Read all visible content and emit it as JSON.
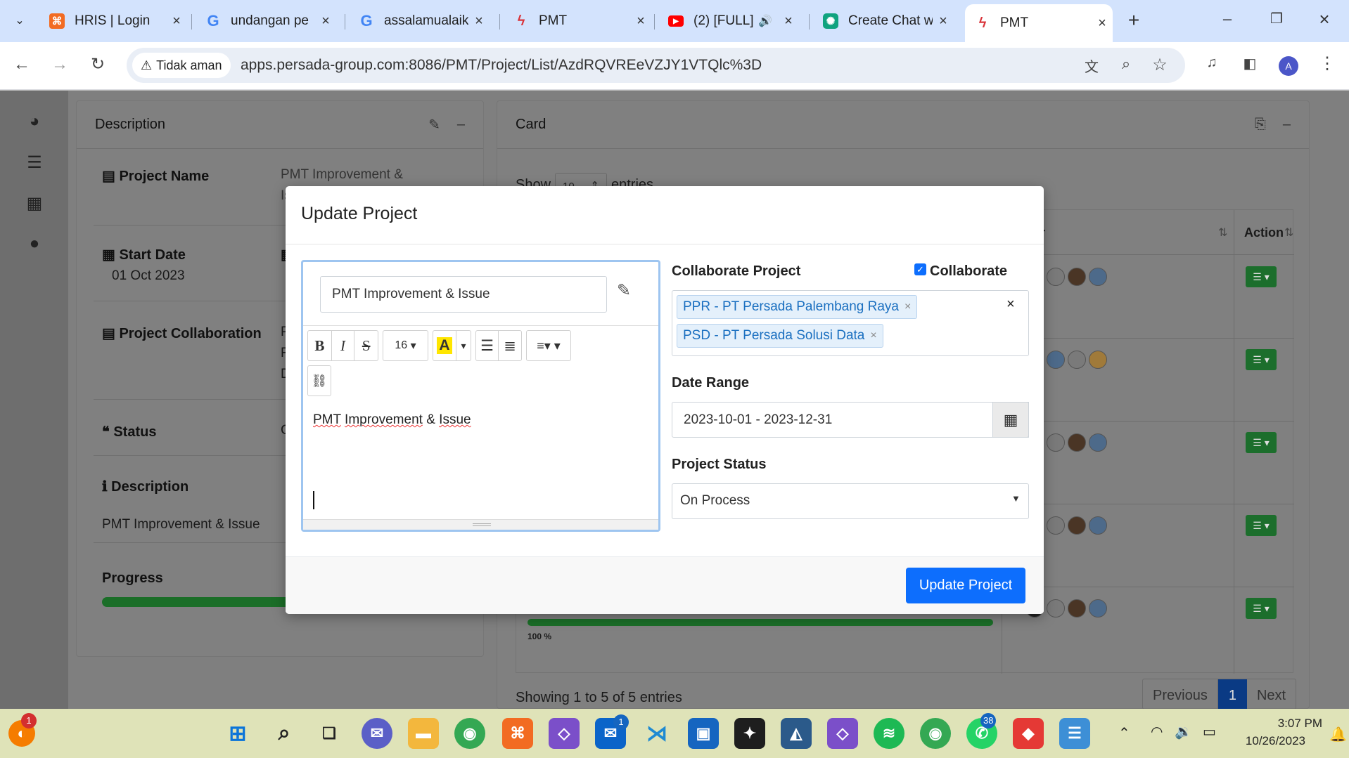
{
  "browser": {
    "tabs": [
      {
        "title": "HRIS | Login",
        "favicon": "hris-icon",
        "color": "#f26b22"
      },
      {
        "title": "undangan pe",
        "favicon": "google-icon",
        "color": "#4285f4"
      },
      {
        "title": "assalamualaik",
        "favicon": "google-icon",
        "color": "#4285f4"
      },
      {
        "title": "PMT",
        "favicon": "pmt-icon",
        "color": "#d9343a"
      },
      {
        "title": "(2) [FULL]",
        "favicon": "youtube-icon",
        "color": "#ff0000"
      },
      {
        "title": "Create Chat w",
        "favicon": "chatgpt-icon",
        "color": "#10a37f"
      },
      {
        "title": "PMT",
        "favicon": "pmt-icon",
        "color": "#d9343a"
      }
    ],
    "security_label": "Tidak aman",
    "url": "apps.persada-group.com:8086/PMT/Project/List/AzdRQVREeVZJY1VTQlc%3D",
    "profile_initial": "A"
  },
  "description_card": {
    "title": "Description",
    "project_name_label": "Project Name",
    "project_name_value": "PMT Improvement &",
    "project_name_value2": "Is",
    "start_date_label": "Start Date",
    "start_date_value": "01 Oct 2023",
    "collab_label": "Project Collaboration",
    "collab_vals": [
      "P",
      "R",
      "D"
    ],
    "status_label": "Status",
    "status_partial": "C",
    "description_label": "Description",
    "description_value": "PMT Improvement & Issue",
    "progress_label": "Progress"
  },
  "card_panel": {
    "title": "Card",
    "show_label": "Show",
    "entries_value": "10",
    "entries_label": "entries",
    "col_member": "ber",
    "col_action": "Action",
    "progress_text": "100 %",
    "showing_text": "Showing 1 to 5 of 5 entries",
    "prev_label": "Previous",
    "page_label": "1",
    "next_label": "Next"
  },
  "modal": {
    "title": "Update Project",
    "project_name": "PMT Improvement & Issue",
    "font_size": "16",
    "editor_text": [
      "PMT",
      "Improvement",
      "&",
      "Issue"
    ],
    "collab_label": "Collaborate Project",
    "collab_checkbox_label": "Collaborate",
    "collab_checked": true,
    "collab_tags": [
      "PPR - PT Persada Palembang Raya",
      "PSD - PT Persada Solusi Data"
    ],
    "date_range_label": "Date Range",
    "date_range_value": "2023-10-01 - 2023-12-31",
    "status_label": "Project Status",
    "status_value": "On Process",
    "submit_label": "Update Project"
  },
  "taskbar": {
    "notif_count": "1",
    "outlook_count": "1",
    "whatsapp_count": "38",
    "time": "3:07 PM",
    "date": "10/26/2023"
  }
}
